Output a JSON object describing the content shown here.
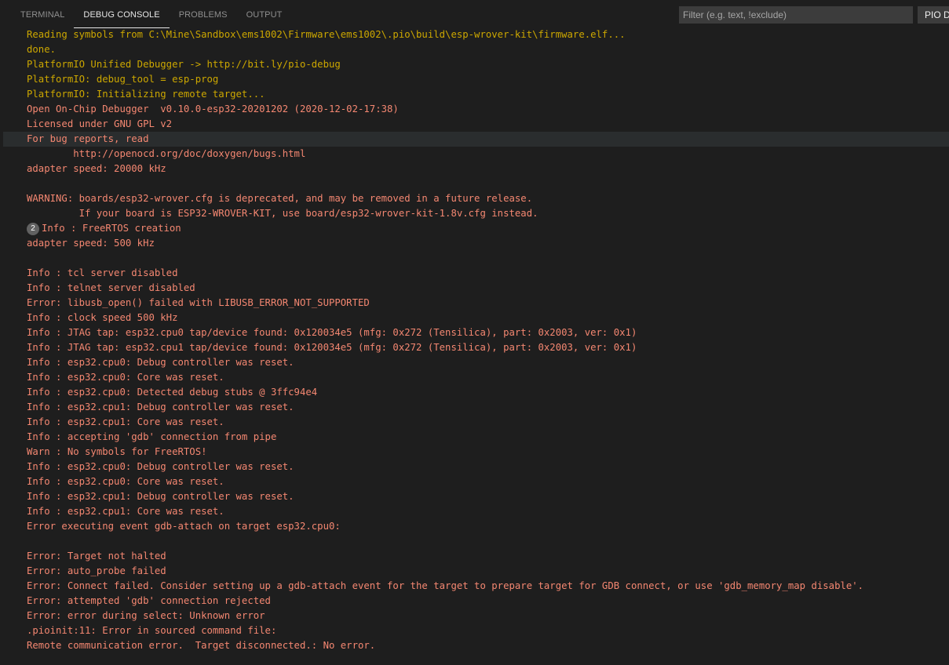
{
  "panel": {
    "tabs": [
      {
        "label": "TERMINAL"
      },
      {
        "label": "DEBUG CONSOLE"
      },
      {
        "label": "PROBLEMS"
      },
      {
        "label": "OUTPUT"
      }
    ],
    "filter_placeholder": "Filter (e.g. text, !exclude)",
    "pio_button_label": "PIO D"
  },
  "colors": {
    "info_output": "#cca700",
    "openocd_output": "#f48771",
    "background": "#1e1e1e"
  },
  "console": {
    "lines": [
      "Reading symbols from C:\\Mine\\Sandbox\\ems1002\\Firmware\\ems1002\\.pio\\build\\esp-wrover-kit\\firmware.elf...",
      "done.",
      "PlatformIO Unified Debugger -> http://bit.ly/pio-debug",
      "PlatformIO: debug_tool = esp-prog",
      "PlatformIO: Initializing remote target...",
      "Open On-Chip Debugger  v0.10.0-esp32-20201202 (2020-12-02-17:38)",
      "Licensed under GNU GPL v2",
      "For bug reports, read",
      "        http://openocd.org/doc/doxygen/bugs.html",
      "adapter speed: 20000 kHz",
      "",
      "WARNING: boards/esp32-wrover.cfg is deprecated, and may be removed in a future release.",
      "         If your board is ESP32-WROVER-KIT, use board/esp32-wrover-kit-1.8v.cfg instead.",
      "Info : FreeRTOS creation",
      "adapter speed: 500 kHz",
      "",
      "Info : tcl server disabled",
      "Info : telnet server disabled",
      "Error: libusb_open() failed with LIBUSB_ERROR_NOT_SUPPORTED",
      "Info : clock speed 500 kHz",
      "Info : JTAG tap: esp32.cpu0 tap/device found: 0x120034e5 (mfg: 0x272 (Tensilica), part: 0x2003, ver: 0x1)",
      "Info : JTAG tap: esp32.cpu1 tap/device found: 0x120034e5 (mfg: 0x272 (Tensilica), part: 0x2003, ver: 0x1)",
      "Info : esp32.cpu0: Debug controller was reset.",
      "Info : esp32.cpu0: Core was reset.",
      "Info : esp32.cpu0: Detected debug stubs @ 3ffc94e4",
      "Info : esp32.cpu1: Debug controller was reset.",
      "Info : esp32.cpu1: Core was reset.",
      "Info : accepting 'gdb' connection from pipe",
      "Warn : No symbols for FreeRTOS!",
      "Info : esp32.cpu0: Debug controller was reset.",
      "Info : esp32.cpu0: Core was reset.",
      "Info : esp32.cpu1: Debug controller was reset.",
      "Info : esp32.cpu1: Core was reset.",
      "Error executing event gdb-attach on target esp32.cpu0:",
      "",
      "Error: Target not halted",
      "Error: auto_probe failed",
      "Error: Connect failed. Consider setting up a gdb-attach event for the target to prepare target for GDB connect, or use 'gdb_memory_map disable'.",
      "Error: attempted 'gdb' connection rejected",
      "Error: error during select: Unknown error",
      ".pioinit:11: Error in sourced command file:",
      "Remote communication error.  Target disconnected.: No error."
    ],
    "repeat_badge": "2"
  }
}
